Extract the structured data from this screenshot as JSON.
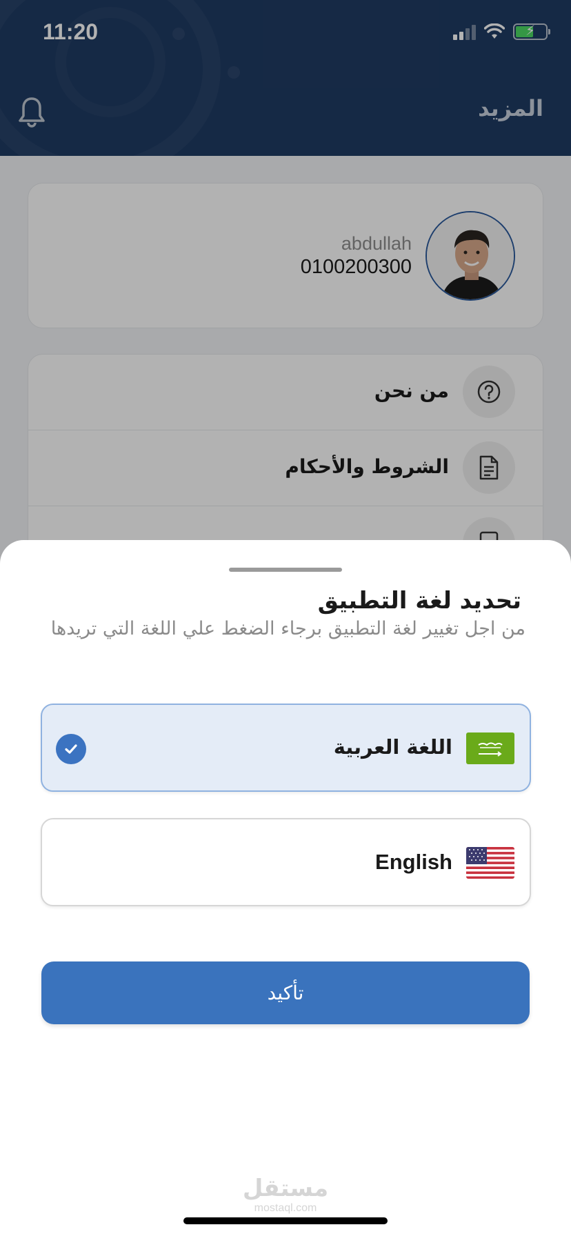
{
  "status_bar": {
    "time": "11:20"
  },
  "header": {
    "title": "المزيد"
  },
  "profile": {
    "name": "abdullah",
    "phone": "0100200300"
  },
  "menu": {
    "items": [
      {
        "label": "من نحن",
        "icon": "question-icon"
      },
      {
        "label": "الشروط والأحكام",
        "icon": "document-icon"
      },
      {
        "label": "",
        "icon": "document-icon"
      }
    ]
  },
  "sheet": {
    "title": "تحديد لغة التطبيق",
    "subtitle": "من اجل تغيير لغة التطبيق برجاء الضغط علي اللغة التي تريدها",
    "options": [
      {
        "label": "اللغة العربية",
        "flag": "saudi-flag-icon",
        "selected": true
      },
      {
        "label": "English",
        "flag": "us-flag-icon",
        "selected": false
      }
    ],
    "confirm_label": "تأكيد"
  },
  "watermark": {
    "arabic": "مستقل",
    "latin": "mostaql.com"
  },
  "colors": {
    "header_bg": "#1f3b63",
    "accent": "#3a73bd",
    "selected_bg": "#e4ecf7",
    "flag_green": "#6aaa1a"
  }
}
